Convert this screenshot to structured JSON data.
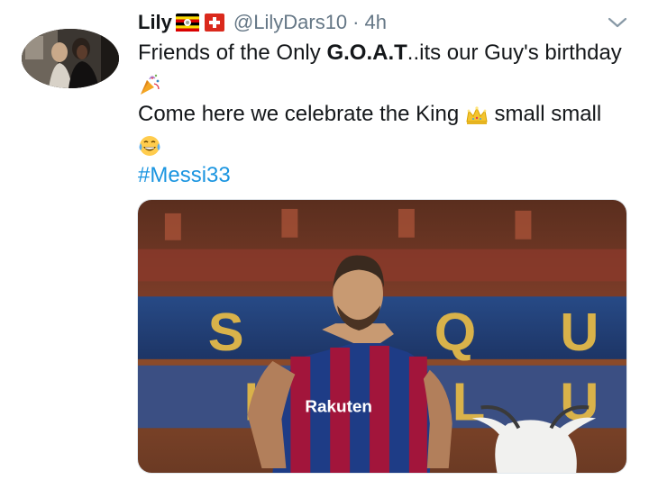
{
  "tweet": {
    "author_name": "Lily",
    "handle": "@LilyDars10",
    "separator": "·",
    "time": "4h",
    "text_line1_before": "Friends of the Only ",
    "text_line1_bold": "G.O.A.T",
    "text_line1_after": "..its our Guy's birthday",
    "text_line2": "Come here we celebrate the King",
    "text_line2_after": " small small",
    "hashtag": "#Messi33",
    "flags": [
      "uganda-flag-icon",
      "switzerland-flag-icon"
    ],
    "emojis": [
      "party-popper-icon",
      "crown-icon",
      "tears-of-joy-icon"
    ],
    "media_sponsor_text": "Rakuten",
    "media_stand_letters": [
      "S",
      "Q",
      "U",
      "L",
      "L",
      "U"
    ]
  },
  "colors": {
    "text": "#14171a",
    "secondary": "#657786",
    "link": "#1b95e0"
  }
}
